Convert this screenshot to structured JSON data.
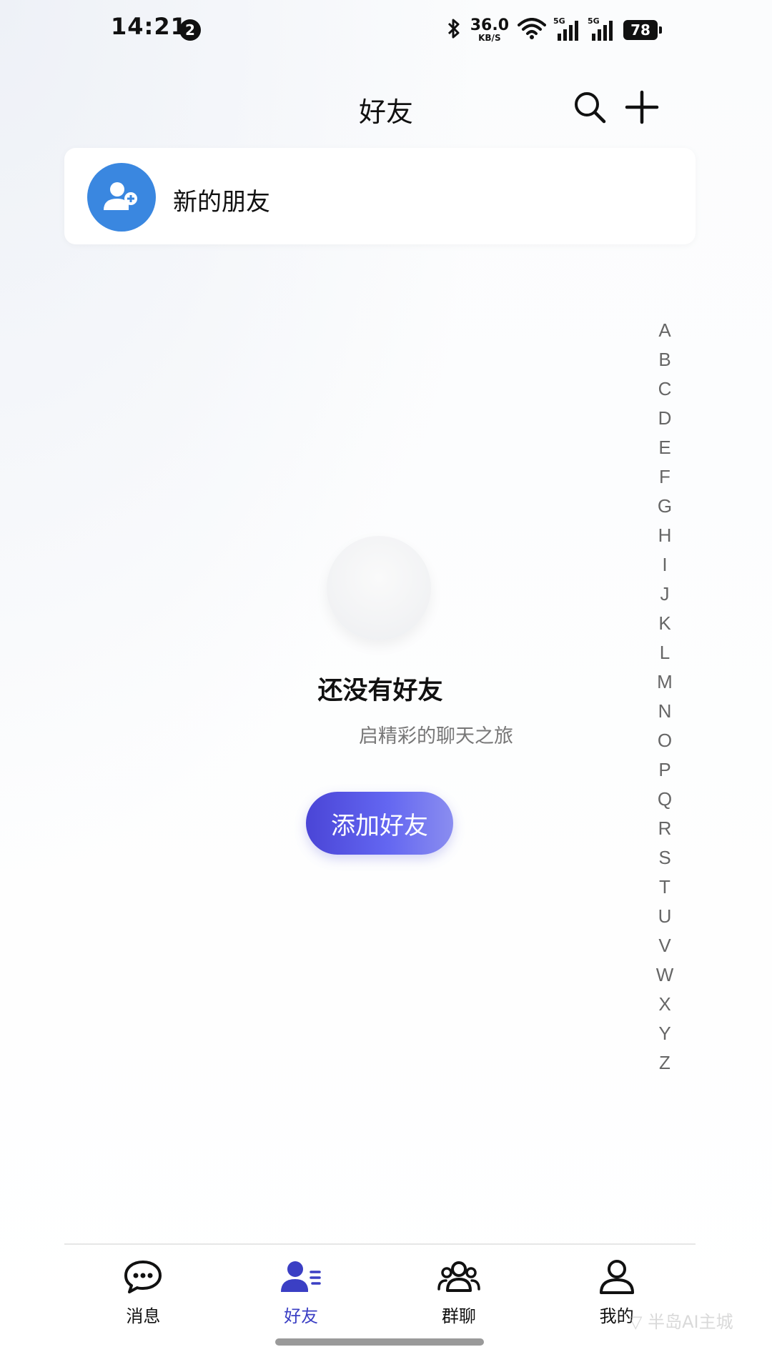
{
  "status_bar": {
    "time": "14:21",
    "notification_count": "2",
    "net_speed_value": "36.0",
    "net_speed_unit": "KB/S",
    "signal_1": "5G",
    "signal_2": "5G",
    "battery": "78"
  },
  "header": {
    "title": "好友",
    "search_icon": "search-icon",
    "add_icon": "plus-icon"
  },
  "new_friends": {
    "label": "新的朋友",
    "icon": "add-user-icon",
    "accent": "#3a87e0"
  },
  "alphabet": [
    "A",
    "B",
    "C",
    "D",
    "E",
    "F",
    "G",
    "H",
    "I",
    "J",
    "K",
    "L",
    "M",
    "N",
    "O",
    "P",
    "Q",
    "R",
    "S",
    "T",
    "U",
    "V",
    "W",
    "X",
    "Y",
    "Z"
  ],
  "empty_state": {
    "title": "还没有好友",
    "subtitle": "启精彩的聊天之旅",
    "button": "添加好友",
    "button_color": "#5a5de0"
  },
  "tabbar": {
    "active_color": "#3b3fc4",
    "items": [
      {
        "label": "消息",
        "icon": "chat-bubble-icon"
      },
      {
        "label": "好友",
        "icon": "friends-icon"
      },
      {
        "label": "群聊",
        "icon": "group-icon"
      },
      {
        "label": "我的",
        "icon": "profile-icon"
      }
    ]
  },
  "watermark": "▽ 半岛AI主城"
}
